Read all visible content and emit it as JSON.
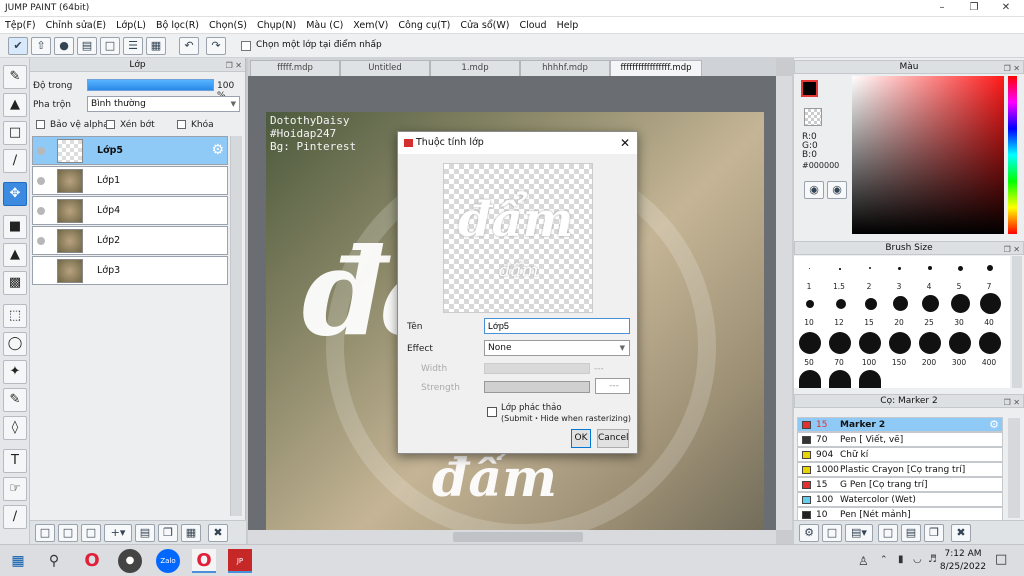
{
  "window": {
    "title": "JUMP PAINT (64bit)"
  },
  "menu": [
    "Tệp(F)",
    "Chỉnh sửa(E)",
    "Lớp(L)",
    "Bộ lọc(R)",
    "Chọn(S)",
    "Chụp(N)",
    "Màu (C)",
    "Xem(V)",
    "Công cụ(T)",
    "Cửa sổ(W)",
    "Cloud",
    "Help"
  ],
  "toolbar": {
    "pick_layer_label": "Chọn một lớp tại điểm nhấp"
  },
  "layer_panel": {
    "title": "Lớp",
    "opacity_label": "Độ trong",
    "opacity_value": "100 %",
    "opacity_percent": 100,
    "blend_label": "Pha trộn",
    "blend_value": "Bình thường",
    "protect_alpha": "Bảo vệ alpha",
    "clip": "Xén bớt",
    "lock": "Khóa",
    "layers": [
      "Lớp5",
      "Lớp1",
      "Lớp4",
      "Lớp2",
      "Lớp3"
    ]
  },
  "tabs": [
    "fffff.mdp",
    "Untitled",
    "1.mdp",
    "hhhhf.mdp",
    "fffffffffffffffff.mdp"
  ],
  "canvas": {
    "wm1": "DotothyDaisy",
    "wm2": "#Hoidap247",
    "wm3": "Bg: Pinterest",
    "art_main": "đẩm",
    "art_bottom": "đẩm"
  },
  "dialog": {
    "title": "Thuộc tính lớp",
    "preview_text": "đẩm",
    "preview_sub": "đẩm",
    "name_label": "Tên",
    "name_value": "Lớp5",
    "effect_label": "Effect",
    "effect_value": "None",
    "width_label": "Width",
    "width_value": "---",
    "strength_label": "Strength",
    "strength_value": "---",
    "draft_label": "Lớp phác thảo",
    "draft_sub": "(Submit・Hide when rasterizing)",
    "ok": "OK",
    "cancel": "Cancel"
  },
  "color_panel": {
    "title": "Màu",
    "r": "R:0",
    "g": "G:0",
    "b": "B:0",
    "hex": "#000000"
  },
  "brush_size": {
    "title": "Brush Size",
    "sizes": [
      "1",
      "1.5",
      "2",
      "3",
      "4",
      "5",
      "7",
      "10",
      "12",
      "15",
      "20",
      "25",
      "30",
      "40",
      "50",
      "70",
      "100",
      "150",
      "200",
      "300",
      "400"
    ]
  },
  "brush_list": {
    "title": "Cọ: Marker 2",
    "items": [
      {
        "size": "15",
        "name": "Marker 2",
        "color": "#e03030"
      },
      {
        "size": "70",
        "name": "Pen [ Viết, vẽ]",
        "color": "#333333"
      },
      {
        "size": "904",
        "name": "Chữ kí",
        "color": "#e8d400"
      },
      {
        "size": "1000",
        "name": "Plastic Crayon [Cọ trang trí]",
        "color": "#e8d400"
      },
      {
        "size": "15",
        "name": "G Pen [Cọ trang trí]",
        "color": "#e03030"
      },
      {
        "size": "100",
        "name": "Watercolor (Wet)",
        "color": "#66ccee"
      },
      {
        "size": "10",
        "name": "Pen [Nét mảnh]",
        "color": "#222222"
      }
    ]
  },
  "taskbar": {
    "time": "7:12 AM",
    "date": "8/25/2022",
    "zalo": "Zalo"
  }
}
